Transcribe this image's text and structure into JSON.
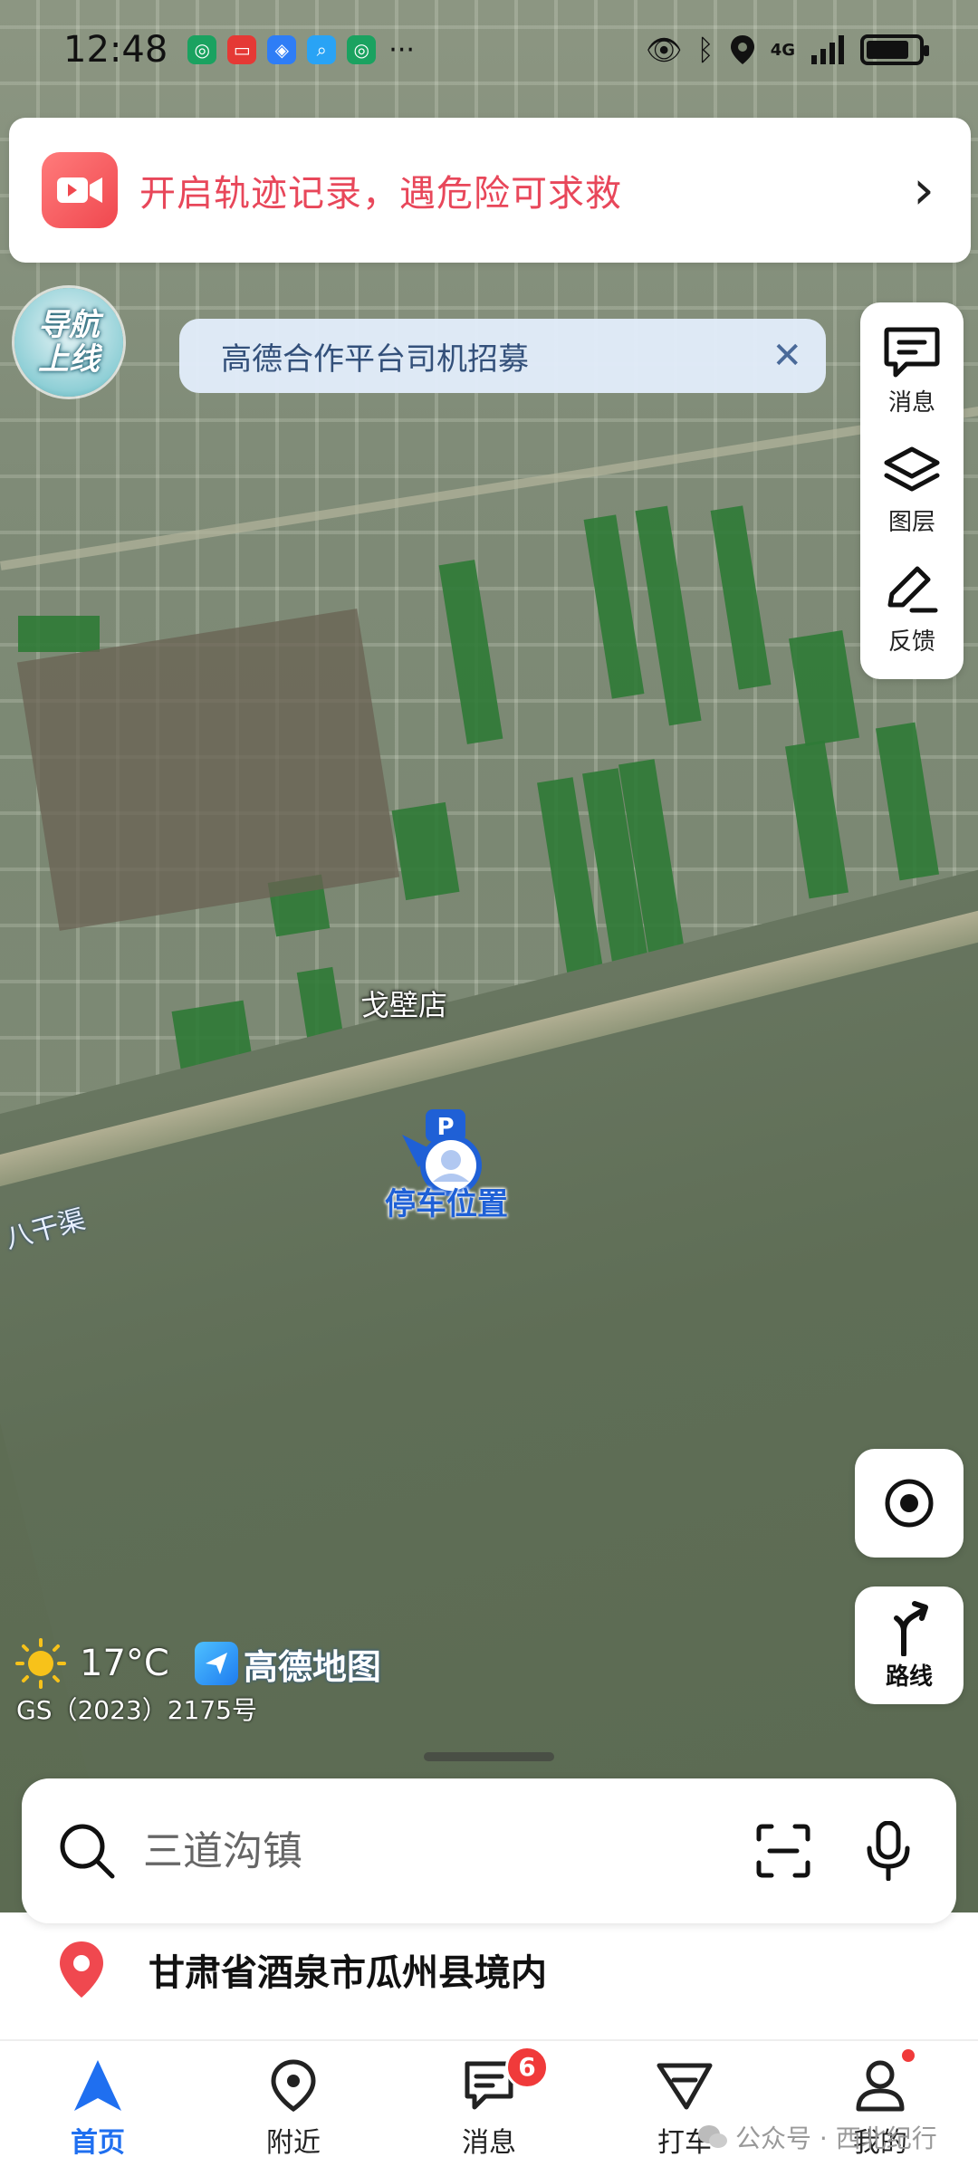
{
  "status_bar": {
    "time": "12:48",
    "more": "···",
    "network": "4G"
  },
  "track_banner": {
    "text": "开启轨迹记录，遇危险可求救",
    "arrow": "›"
  },
  "nav_badge": {
    "line1": "导航",
    "line2": "上线"
  },
  "recruit_banner": {
    "text": "高德合作平台司机招募",
    "close": "✕"
  },
  "tool_panel": {
    "items": [
      {
        "label": "消息",
        "icon": "message-icon"
      },
      {
        "label": "图层",
        "icon": "layers-icon"
      },
      {
        "label": "反馈",
        "icon": "edit-icon"
      }
    ]
  },
  "map": {
    "place_label": "戈壁店",
    "canal_label": "八干渠",
    "parking_label": "停车位置"
  },
  "buttons": {
    "route_label": "路线"
  },
  "weather": {
    "temperature": "17°C",
    "brand": "高德地图",
    "license": "GS（2023）2175号"
  },
  "search": {
    "placeholder": "三道沟镇"
  },
  "location": {
    "text": "甘肃省酒泉市瓜州县境内"
  },
  "tabs": [
    {
      "label": "首页",
      "icon": "home-arrow-icon",
      "active": true
    },
    {
      "label": "附近",
      "icon": "nearby-pin-icon",
      "active": false
    },
    {
      "label": "消息",
      "icon": "chat-icon",
      "active": false,
      "badge": "6"
    },
    {
      "label": "打车",
      "icon": "taxi-icon",
      "active": false
    },
    {
      "label": "我的",
      "icon": "profile-icon",
      "active": false
    }
  ],
  "watermark": {
    "text": "公众号 · 西北纪行"
  },
  "colors": {
    "accent": "#1f6ff0",
    "alert": "#e8475a",
    "badge": "#f03a3a"
  }
}
